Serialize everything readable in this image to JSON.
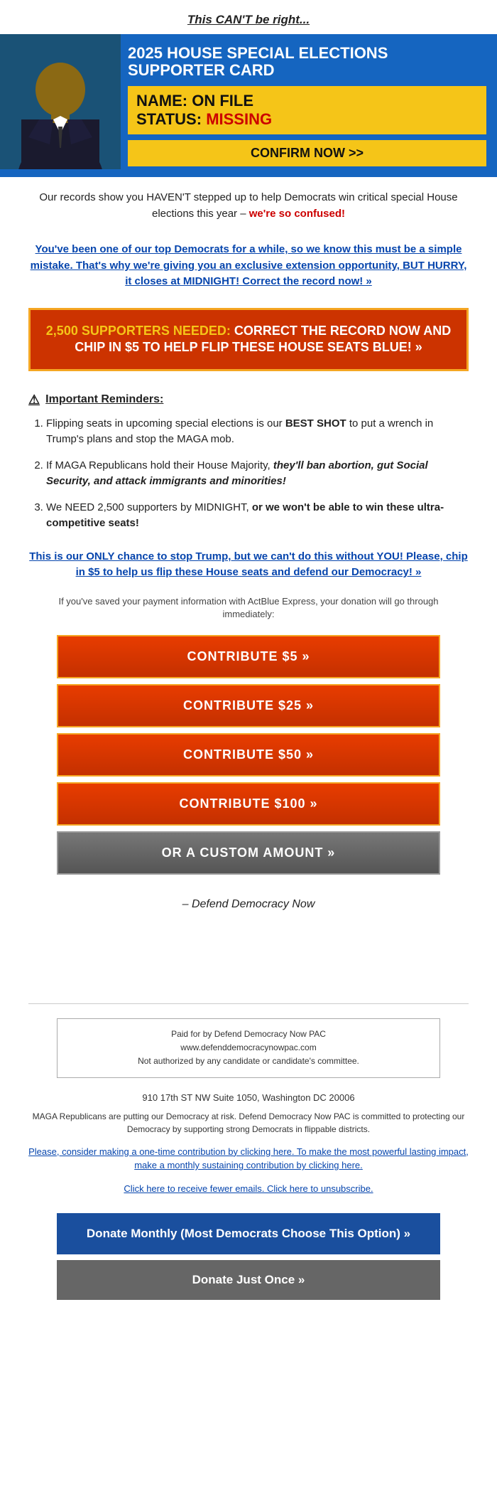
{
  "header": {
    "title": "This CAN'T be right..."
  },
  "hero": {
    "title": "2025 HOUSE SPECIAL ELECTIONS SUPPORTER CARD",
    "name_label": "NAME:",
    "name_value": "ON FILE",
    "status_label": "STATUS:",
    "status_value": "MISSING",
    "cta": "CONFIRM NOW >>"
  },
  "body": {
    "intro": "Our records show you HAVEN'T stepped up to help Democrats win critical special House elections this year – we're so confused!",
    "link_text": "You've been one of our top Democrats for a while, so we know this must be a simple mistake. That's why we're giving you an exclusive extension opportunity, BUT HURRY, it closes at MIDNIGHT! Correct the record now! »",
    "cta_box": {
      "highlight": "2,500 SUPPORTERS NEEDED:",
      "text": " CORRECT THE RECORD NOW AND CHIP IN $5 TO HELP FLIP THESE HOUSE SEATS BLUE! »"
    },
    "reminders_title": "Important Reminders:",
    "reminders": [
      {
        "text": "Flipping seats in upcoming special elections is our BEST SHOT to put a wrench in Trump's plans and stop the MAGA mob."
      },
      {
        "text_before": "If MAGA Republicans hold their House Majority, ",
        "text_italic": "they'll ban abortion, gut Social Security, and attack immigrants and minorities!",
        "text_after": ""
      },
      {
        "text_before": "We NEED 2,500 supporters by MIDNIGHT, ",
        "text_bold": "or we won't be able to win these ultra-competitive seats!",
        "text_after": ""
      }
    ],
    "bottom_link": "This is our ONLY chance to stop Trump, but we can't do this without YOU! Please, chip in $5 to help us flip these House seats and defend our Democracy! »",
    "payment_notice": "If you've saved your payment information with ActBlue Express, your donation will go through immediately:",
    "buttons": [
      {
        "label": "CONTRIBUTE $5 »",
        "type": "red"
      },
      {
        "label": "CONTRIBUTE $25 »",
        "type": "red"
      },
      {
        "label": "CONTRIBUTE $50 »",
        "type": "red"
      },
      {
        "label": "CONTRIBUTE $100 »",
        "type": "red"
      },
      {
        "label": "OR A CUSTOM AMOUNT »",
        "type": "gray"
      }
    ],
    "sign_off": "– Defend Democracy Now",
    "custom_amount_label": "OR CUSTOM AMOUNT"
  },
  "footer": {
    "paid_for": "Paid for by Defend Democracy Now PAC",
    "website": "www.defenddemocracynowpac.com",
    "disclaimer": "Not authorized by any candidate or candidate's committee.",
    "address": "910 17th ST NW Suite 1050, Washington DC 20006",
    "maga_text": "MAGA Republicans are putting our Democracy at risk. Defend Democracy Now PAC is committed to protecting our Democracy by supporting strong Democrats in flippable districts.",
    "one_time_text": "Please, consider making a ",
    "one_time_link": "one-time contribution by clicking here",
    "sustaining_text": ". To make the most powerful lasting impact, make a ",
    "sustaining_link": "monthly sustaining contribution by clicking here",
    "sustaining_end": ".",
    "click_here_text": "Click here",
    "unsubscribe_text": " to receive fewer emails. Click here to unsubscribe.",
    "donate_monthly_btn": "Donate Monthly (Most Democrats Choose This Option) »",
    "donate_once_btn": "Donate Just Once »"
  }
}
